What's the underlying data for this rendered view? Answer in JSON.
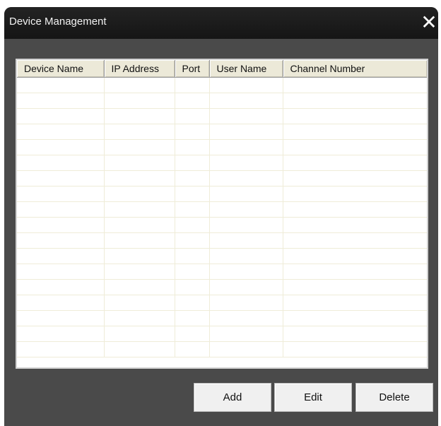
{
  "window": {
    "title": "Device Management"
  },
  "grid": {
    "columns": [
      "Device Name",
      "IP Address",
      "Port",
      "User Name",
      "Channel Number"
    ]
  },
  "buttons": {
    "add": "Add",
    "edit": "Edit",
    "delete": "Delete"
  }
}
